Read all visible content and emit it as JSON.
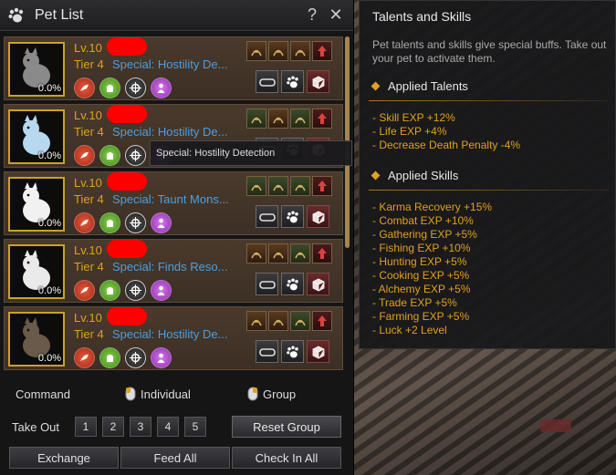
{
  "window": {
    "title": "Pet List",
    "help": "?",
    "close": "✕"
  },
  "pets": [
    {
      "level": "Lv.10",
      "tier": "Tier 4",
      "special": "Special: Hostility De...",
      "pct": "0.0%",
      "color": "#8a8a8a"
    },
    {
      "level": "Lv.10",
      "tier": "Tier 4",
      "special": "Special: Hostility De...",
      "pct": "0.0%",
      "color": "#b7d8ee"
    },
    {
      "level": "Lv.10",
      "tier": "Tier 4",
      "special": "Special: Taunt Mons...",
      "pct": "0.0%",
      "color": "#f1f1f1"
    },
    {
      "level": "Lv.10",
      "tier": "Tier 4",
      "special": "Special: Finds Reso...",
      "pct": "0.0%",
      "color": "#eaeaea"
    },
    {
      "level": "Lv.10",
      "tier": "Tier 4",
      "special": "Special: Hostility De...",
      "pct": "0.0%",
      "color": "#6a5a4a"
    }
  ],
  "tooltip_inline": "Special: Hostility Detection",
  "footer": {
    "command": "Command",
    "individual": "Individual",
    "group": "Group",
    "take_out": "Take Out",
    "slots": [
      "1",
      "2",
      "3",
      "4",
      "5"
    ],
    "reset_group": "Reset Group",
    "exchange": "Exchange",
    "feed_all": "Feed All",
    "check_in_all": "Check In All"
  },
  "talents_panel": {
    "title": "Talents and Skills",
    "desc": "Pet talents and skills give special buffs. Take out your pet to activate them.",
    "applied_talents_heading": "Applied Talents",
    "applied_talents": [
      "- Skill EXP +12%",
      "- Life EXP +4%",
      "- Decrease Death Penalty -4%"
    ],
    "applied_skills_heading": "Applied Skills",
    "applied_skills": [
      "- Karma Recovery +15%",
      "- Combat EXP +10%",
      "- Gathering EXP +5%",
      "- Fishing EXP +10%",
      "- Hunting EXP +5%",
      "- Cooking EXP +5%",
      "- Alchemy EXP +5%",
      "- Trade EXP +5%",
      "- Farming EXP +5%",
      "- Luck +2 Level"
    ]
  },
  "colors": {
    "accent": "#e0a020",
    "special_link": "#4b9fe0",
    "frame": "#c9a227"
  }
}
